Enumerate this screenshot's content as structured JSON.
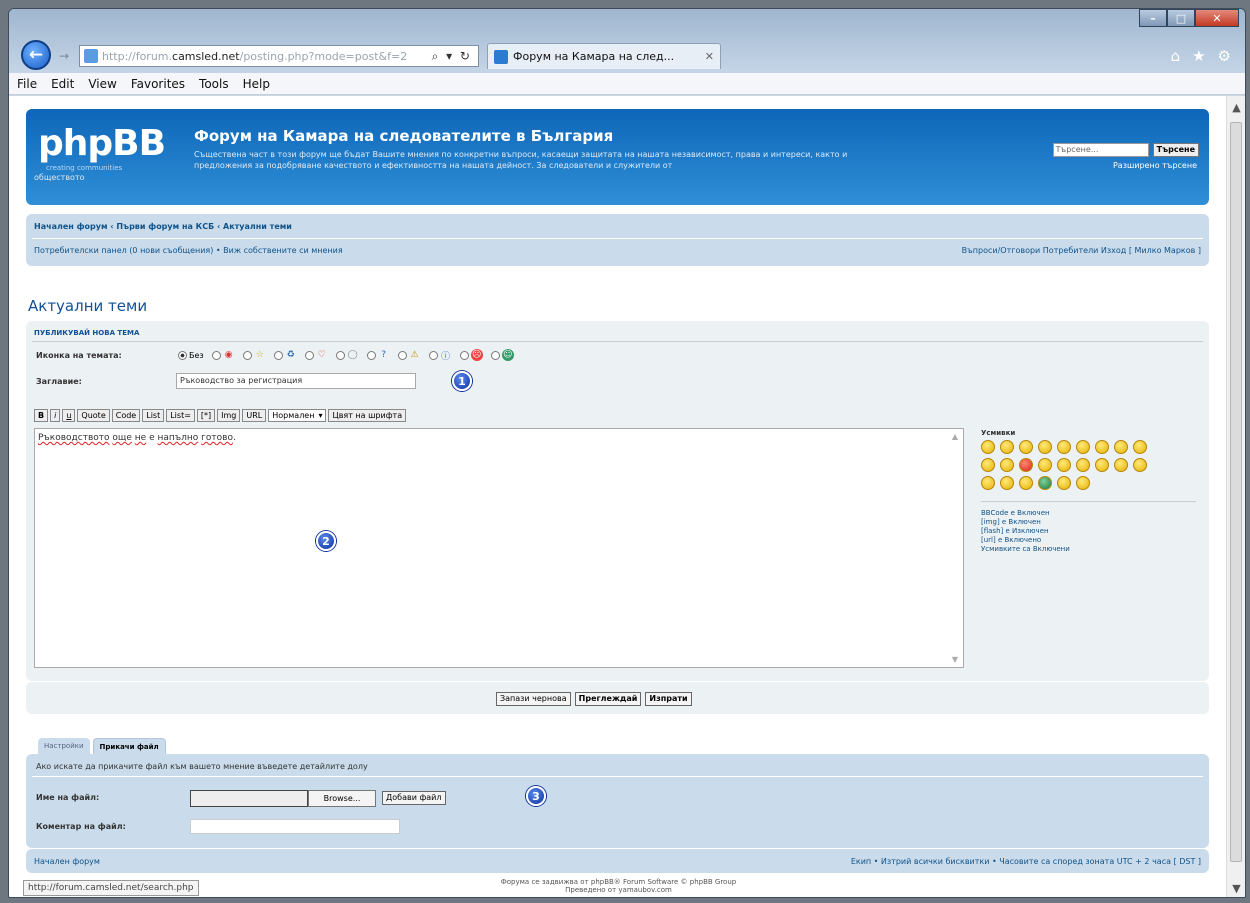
{
  "browser": {
    "url_prefix": "http://forum.",
    "url_domain": "camsled.net",
    "url_suffix": "/posting.php?mode=post&f=2",
    "tab_title": "Форум на Камара на след...",
    "menu": [
      "File",
      "Edit",
      "View",
      "Favorites",
      "Tools",
      "Help"
    ],
    "status_url": "http://forum.camsled.net/search.php"
  },
  "header": {
    "logo": "phpBB",
    "logo_sub": "creating communities",
    "site_title": "Форум на Камара на следователите в България",
    "site_desc": "Съществена част в този форум ще бъдат Вашите мнения по конкретни въпроси, касаещи защитата на нашата независимост, права и интереси, както и предложения за подобряване качеството и ефективността на нашата дейност. За следователи и служители от",
    "site_desc2": "обществото",
    "search_placeholder": "Търсене...",
    "search_button": "Търсене",
    "advanced_search": "Разширено търсене"
  },
  "nav": {
    "breadcrumb": "Начален форум ‹ Първи форум на КСБ ‹ Актуални теми",
    "ucp": "Потребителски панел (0 нови съобщения) • Виж собствените си мнения",
    "right": "Въпроси/Отговори  Потребители  Изход [ Милко Марков ]"
  },
  "page_title": "Актуални теми",
  "post": {
    "heading": "Публикувай нова тема",
    "icon_label": "Иконка на темата:",
    "icon_none": "Без",
    "subject_label": "Заглавие:",
    "subject_value": "Ръководство за регистрация",
    "toolbar": [
      "B",
      "i",
      "u",
      "Quote",
      "Code",
      "List",
      "List=",
      "[*]",
      "Img",
      "URL"
    ],
    "font_size": "Нормален",
    "font_color": "Цвят на шрифта",
    "message_words": [
      {
        "t": "Ръководството",
        "err": true
      },
      {
        "t": " ",
        "err": false
      },
      {
        "t": "още",
        "err": true
      },
      {
        "t": " ",
        "err": false
      },
      {
        "t": "не",
        "err": true
      },
      {
        "t": " е ",
        "err": false
      },
      {
        "t": "напълно",
        "err": true
      },
      {
        "t": " ",
        "err": false
      },
      {
        "t": "готово",
        "err": true
      },
      {
        "t": ".",
        "err": false
      }
    ],
    "smilies_label": "Усмивки",
    "bbcode_info": [
      "BBCode е Включен",
      "[img] е Включен",
      "[flash] е Изключен",
      "[url] е Включено",
      "Усмивките са Включени"
    ],
    "buttons": {
      "draft": "Запази чернова",
      "preview": "Преглеждай",
      "submit": "Изпрати"
    }
  },
  "badges": {
    "b1": "1",
    "b2": "2",
    "b3": "3"
  },
  "attach": {
    "tab_options": "Настройки",
    "tab_upload": "Прикачи файл",
    "desc": "Ако искате да прикачите файл към вашето мнение въведете детайлите долу",
    "file_label": "Име на файл:",
    "browse": "Browse...",
    "add_file": "Добави файл",
    "comment_label": "Коментар на файл:"
  },
  "footer": {
    "left": "Начален форум",
    "right": "Екип • Изтрий всички бисквитки • Часовите са според зоната UTC + 2 часа [ DST ]",
    "copyright_1": "Форума се задвижва от phpBB® Forum Software © phpBB Group",
    "copyright_2": "Преведено от yamaubov.com"
  },
  "colors": {
    "header_blue": "#105289",
    "nav_bg": "#cadceb",
    "panel_bg": "#ecf1f3"
  }
}
